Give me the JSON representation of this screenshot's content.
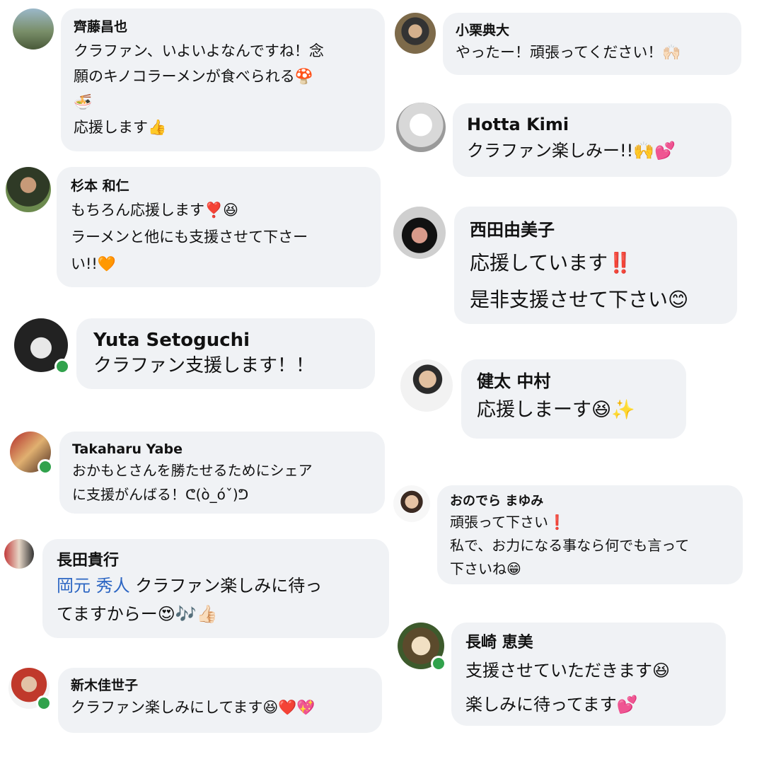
{
  "comments": [
    {
      "name": "齊藤昌也",
      "lines": [
        "クラファン、いよいよなんですね！念",
        "願のキノコラーメンが食べられる🍄",
        "🍜",
        "応援します👍"
      ]
    },
    {
      "name": "杉本 和仁",
      "lines": [
        "もちろん応援します❣️😆",
        "ラーメンと他にも支援させて下さー",
        "い!!🧡"
      ]
    },
    {
      "name": "Yuta Setoguchi",
      "lines": [
        "クラファン支援します！！"
      ]
    },
    {
      "name": "Takaharu Yabe",
      "lines": [
        "おかもとさんを勝たせるためにシェア",
        "に支援がんばる！ᕦ(ò_óˇ)ᕤ"
      ]
    },
    {
      "name": "長田貴行",
      "mention": "岡元 秀人",
      "lines": [
        " クラファン楽しみに待っ",
        "てますからー😍🎶👍🏻"
      ]
    },
    {
      "name": "新木佳世子",
      "lines": [
        "クラファン楽しみにしてます😆❤️💖"
      ]
    },
    {
      "name": "小栗典大",
      "lines": [
        "やったー！頑張ってください！🙌🏻"
      ]
    },
    {
      "name": "Hotta Kimi",
      "lines": [
        "クラファン楽しみー!!🙌💕"
      ]
    },
    {
      "name": "西田由美子",
      "lines": [
        "応援しています‼️",
        "是非支援させて下さい😊"
      ]
    },
    {
      "name": "健太 中村",
      "lines": [
        "応援しまーす😆✨"
      ]
    },
    {
      "name": "おのでら まゆみ",
      "lines": [
        "頑張って下さい❗️",
        "私で、お力になる事なら何でも言って",
        "下さいね😁"
      ]
    },
    {
      "name": "長崎 恵美",
      "lines": [
        "支援させていただきます😆",
        "楽しみに待ってます💕"
      ]
    }
  ],
  "icons": {
    "avatar": "avatar-photo",
    "online": "online-status-dot"
  }
}
